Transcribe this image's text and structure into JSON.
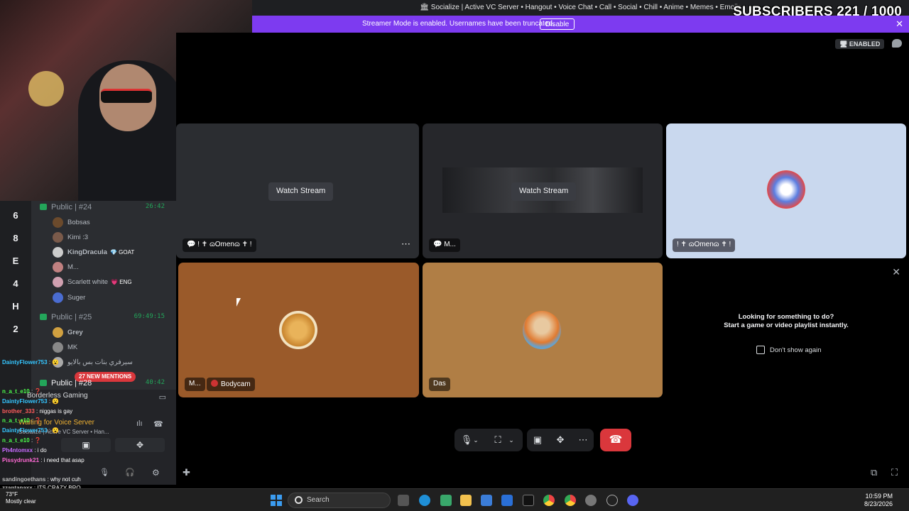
{
  "window": {
    "title": "🏛 Socialize | Active VC Server • Hangout • Voice Chat • Call • Social • Chill • Anime • Memes • Emojis",
    "overlay_counter": "SUBSCRIBERS 221 / 1000"
  },
  "banner": {
    "text": "Streamer Mode is enabled. Usernames have been truncated.",
    "disable_label": "Disable",
    "close_glyph": "✕"
  },
  "stage": {
    "enabled_badge": "🖥 ENABLED",
    "tiles": [
      {
        "name": "💬 ! ✝ ɷOmenɷ ✝ !",
        "watch_label": "Watch Stream",
        "more": "⋯"
      },
      {
        "name": "💬 M...",
        "watch_label": "Watch Stream"
      },
      {
        "name": "! ✝ ɷOmenɷ ✝ !"
      },
      {
        "name": "M...",
        "activity": "Bodycam"
      },
      {
        "name": "Das"
      }
    ]
  },
  "task_panel": {
    "close_glyph": "✕",
    "title": "Looking for something to do?",
    "subtitle": "Start a game or video playlist instantly.",
    "checkbox_label": "Don't show again"
  },
  "server_rail": [
    "6",
    "8",
    "E",
    "4",
    "H",
    "2"
  ],
  "voice_channels": [
    {
      "name": "Public | #24",
      "timer": "26:42",
      "users": [
        {
          "name": "Bobsas",
          "color": "#6b4a2c"
        },
        {
          "name": "Kimi :3",
          "color": "#7a5a4a"
        },
        {
          "name": "KingDracula",
          "tag": "💎 GOAT",
          "color": "#cccccc"
        },
        {
          "name": "M...",
          "color": "#c08080"
        },
        {
          "name": "Scarlett white",
          "tag": "💗 ENG",
          "color": "#d0a0b0"
        },
        {
          "name": "Suger",
          "color": "#4a6cd0"
        }
      ]
    },
    {
      "name": "Public | #25",
      "timer": "69:49:15",
      "users": [
        {
          "name": "Grey",
          "color": "#d0a040"
        },
        {
          "name": "MK",
          "color": "#888888"
        },
        {
          "name": "سيرفري بنات بس بالايو",
          "color": "#aaaaaa"
        }
      ]
    },
    {
      "name": "Public | #28",
      "timer": "40:42",
      "users": []
    }
  ],
  "mentions_pill": "27 NEW MENTIONS",
  "bottom_panel": {
    "activity": "Borderless Gaming",
    "voice_status": "Waiting for Voice Server",
    "voice_server": "Socialize | Active VC Server • Han..."
  },
  "twitch_chat": [
    {
      "user": "DaintyFlower753",
      "msg": ": 😮",
      "color": "#35c6ff"
    },
    {
      "user": "n_a_t_e10",
      "msg": ": ❓",
      "color": "#4cff4c"
    },
    {
      "user": "DaintyFlower753",
      "msg": ": 😮",
      "color": "#35c6ff"
    },
    {
      "user": "brother_333",
      "msg": ": niggas is gay",
      "color": "#ff5c5c"
    },
    {
      "user": "n_a_t_e10",
      "msg": ": ❓",
      "color": "#4cff4c"
    },
    {
      "user": "DaintyFlower753",
      "msg": ": 😮",
      "color": "#35c6ff"
    },
    {
      "user": "n_a_t_e10",
      "msg": ": ❓",
      "color": "#4cff4c"
    },
    {
      "user": "Ph4ntomxx",
      "msg": ": i do",
      "color": "#c86bff"
    },
    {
      "user": "Pissydrunk21",
      "msg": ": i need that asap",
      "color": "#ff6ad5"
    },
    {
      "user": "sandingoethans",
      "msg": ": why not cuh",
      "color": "#bbbbbb"
    },
    {
      "user": "zzantanaxx",
      "msg": ": ITS CRAZY BRO",
      "color": "#bbbbbb"
    }
  ],
  "taskbar": {
    "weather_temp": "73°F",
    "weather_desc": "Mostly clear",
    "search_label": "Search",
    "time": "10:59 PM",
    "date": "8/23/2026"
  }
}
